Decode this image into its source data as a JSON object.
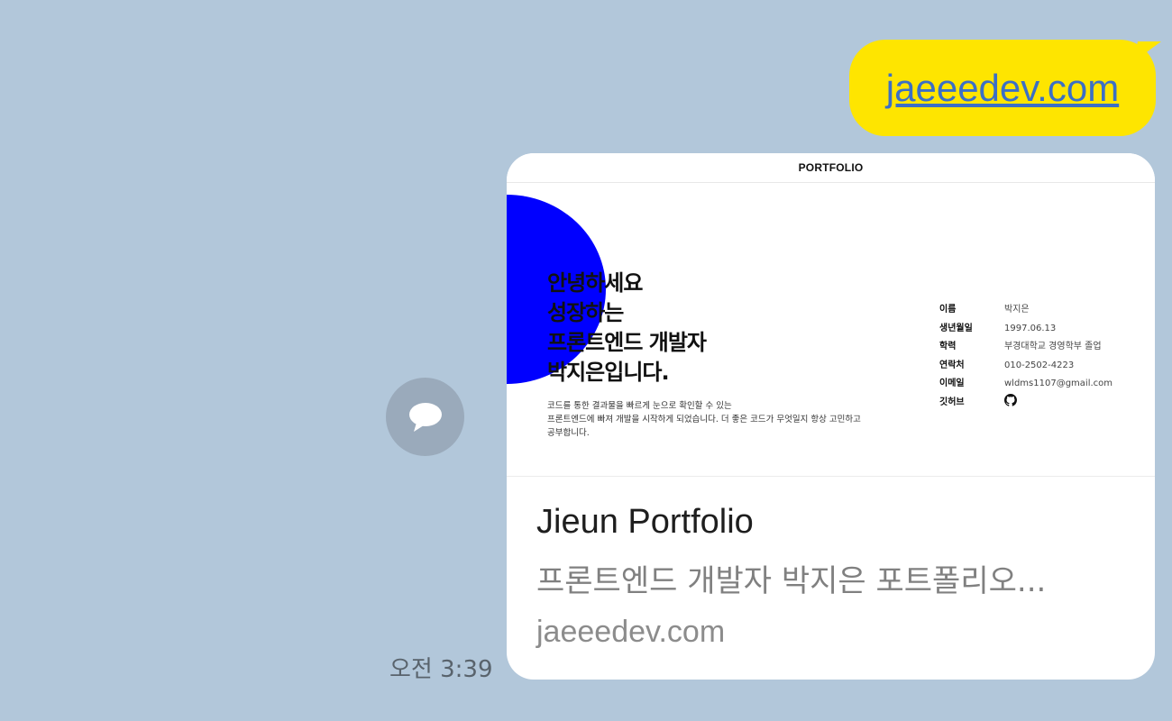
{
  "message": {
    "link_text": "jaeeedev.com"
  },
  "timestamp": "오전 3:39",
  "preview": {
    "header": "PORTFOLIO",
    "hero_lines": [
      "안녕하세요",
      "성장하는",
      "프론트엔드 개발자",
      "박지은입니다."
    ],
    "intro_lines": [
      "코드를 통한 결과물을 빠르게 눈으로 확인할 수 있는",
      "프론트엔드에 빠져 개발을 시작하게 되었습니다. 더 좋은 코드가 무엇일지 항상 고민하고",
      "공부합니다."
    ],
    "info": [
      {
        "label": "이름",
        "value": "박지은"
      },
      {
        "label": "생년월일",
        "value": "1997.06.13"
      },
      {
        "label": "학력",
        "value": "부경대학교 경영학부 졸업"
      },
      {
        "label": "연락처",
        "value": "010-2502-4223"
      },
      {
        "label": "이메일",
        "value": "wldms1107@gmail.com"
      },
      {
        "label": "깃허브",
        "value": ""
      }
    ],
    "github_icon": "github-icon",
    "accent_color": "#0000ff"
  },
  "card": {
    "title": "Jieun Portfolio",
    "description": "프론트엔드 개발자 박지은 포트폴리오...",
    "domain": "jaeeedev.com"
  },
  "colors": {
    "background": "#b2c7da",
    "bubble": "#fee500",
    "link": "#3b6fc6"
  },
  "icons": {
    "share": "speech-bubble-icon"
  }
}
